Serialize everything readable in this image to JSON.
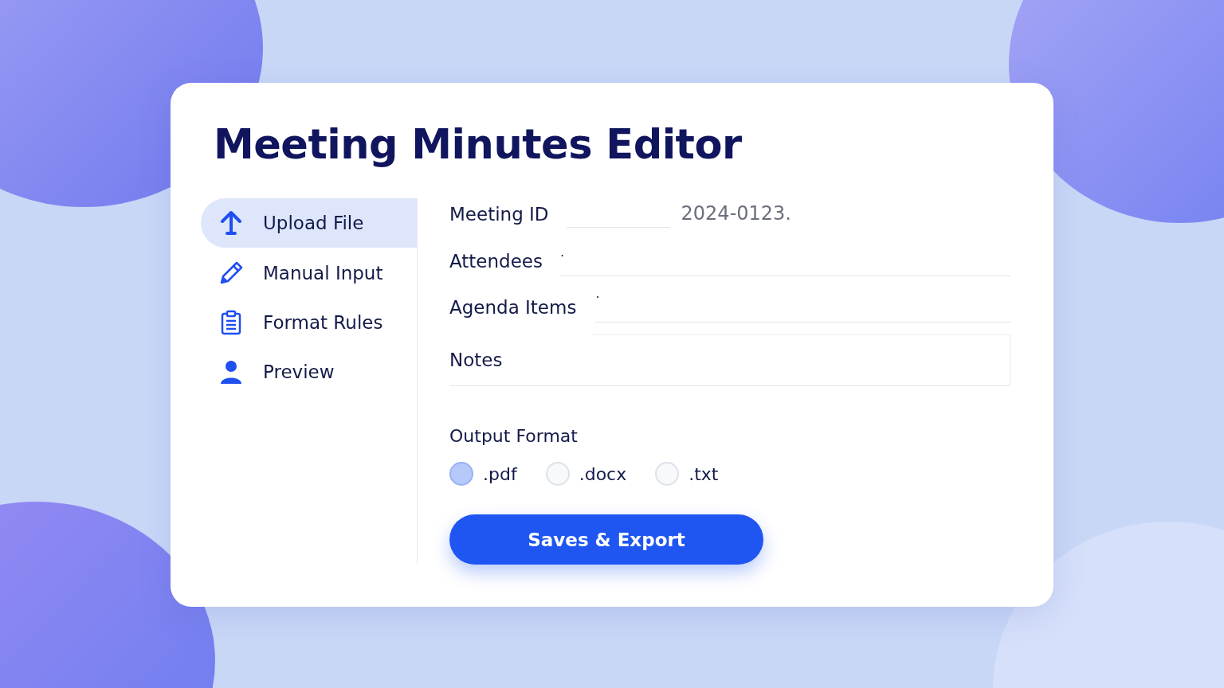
{
  "title": "Meeting Minutes Editor",
  "sidebar": {
    "items": [
      {
        "label": "Upload File",
        "kind": "upload",
        "selected": true
      },
      {
        "label": "Manual Input",
        "kind": "pencil",
        "selected": false
      },
      {
        "label": "Format Rules",
        "kind": "clipboard",
        "selected": false
      },
      {
        "label": "Preview",
        "kind": "person",
        "selected": false
      }
    ]
  },
  "form": {
    "fields": [
      {
        "label": "Meeting ID",
        "kind": "short",
        "value": "2024-0123."
      },
      {
        "label": "Attendees",
        "kind": "line",
        "value": "·"
      },
      {
        "label": "Agenda Items",
        "kind": "line",
        "value": "·"
      },
      {
        "label": "Notes",
        "kind": "box"
      }
    ]
  },
  "output_format": {
    "label": "Output Format",
    "options": [
      {
        "label": ".pdf",
        "selected": true
      },
      {
        "label": ".docx",
        "selected": false
      },
      {
        "label": ".txt",
        "selected": false
      }
    ]
  },
  "button": "Saves & Export"
}
